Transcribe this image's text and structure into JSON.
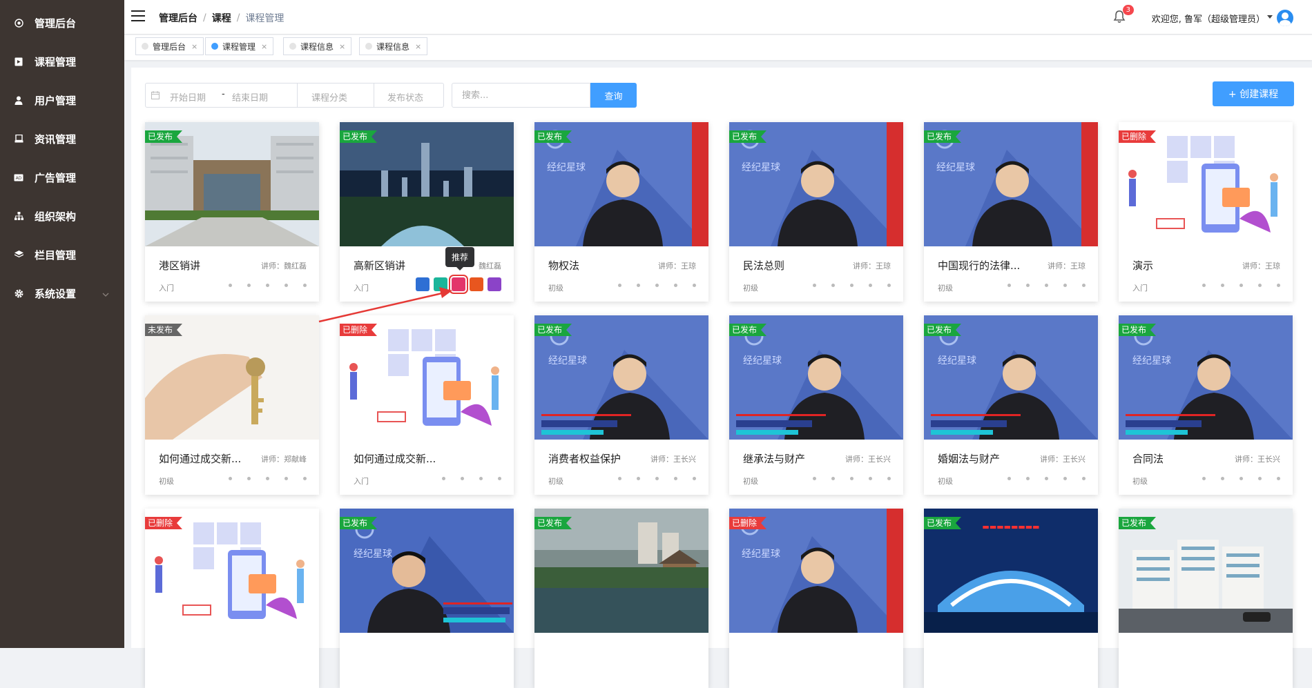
{
  "sidebar": {
    "items": [
      {
        "label": "管理后台",
        "icon": "dashboard-icon"
      },
      {
        "label": "课程管理",
        "icon": "course-icon"
      },
      {
        "label": "用户管理",
        "icon": "user-icon"
      },
      {
        "label": "资讯管理",
        "icon": "news-icon"
      },
      {
        "label": "广告管理",
        "icon": "ad-icon"
      },
      {
        "label": "组织架构",
        "icon": "org-icon"
      },
      {
        "label": "栏目管理",
        "icon": "layers-icon"
      },
      {
        "label": "系统设置",
        "icon": "gear-icon"
      }
    ]
  },
  "header": {
    "breadcrumb": [
      "管理后台",
      "课程",
      "课程管理"
    ],
    "notification_count": "3",
    "welcome": "欢迎您,  鲁军（超级管理员）"
  },
  "tabs": [
    {
      "label": "管理后台",
      "active": false
    },
    {
      "label": "课程管理",
      "active": true
    },
    {
      "label": "课程信息",
      "active": false
    },
    {
      "label": "课程信息",
      "active": false
    }
  ],
  "tab_close": "×",
  "filters": {
    "start_placeholder": "开始日期",
    "separator": "-",
    "end_placeholder": "结束日期",
    "category_placeholder": "课程分类",
    "status_placeholder": "发布状态",
    "search_placeholder": "搜索...",
    "query_label": "查询",
    "create_label": "+ 创建课程"
  },
  "tooltip": "推荐",
  "courses": [
    {
      "status": "已发布",
      "title": "港区销讲",
      "teacher": "讲师：魏红磊",
      "level": "入门",
      "thumb": "building"
    },
    {
      "status": "已发布",
      "title": "高新区销讲",
      "teacher": "魏红磊",
      "level": "入门",
      "thumb": "city"
    },
    {
      "status": "已发布",
      "title": "物权法",
      "teacher": "讲师：王琼",
      "level": "初级",
      "thumb": "video"
    },
    {
      "status": "已发布",
      "title": "民法总则",
      "teacher": "讲师：王琼",
      "level": "初级",
      "thumb": "video"
    },
    {
      "status": "已发布",
      "title": "中国现行的法律...",
      "teacher": "讲师：王琼",
      "level": "初级",
      "thumb": "video"
    },
    {
      "status": "已删除",
      "title": "演示",
      "teacher": "讲师：王琼",
      "level": "入门",
      "thumb": "illustration"
    },
    {
      "status": "未发布",
      "title": "如何通过成交新...",
      "teacher": "讲师：郑献峰",
      "level": "初级",
      "thumb": "key"
    },
    {
      "status": "已删除",
      "title": "如何通过成交新...",
      "teacher": "",
      "level": "入门",
      "thumb": "illustration"
    },
    {
      "status": "已发布",
      "title": "消费者权益保护",
      "teacher": "讲师：王长兴",
      "level": "初级",
      "thumb": "video2"
    },
    {
      "status": "已发布",
      "title": "继承法与财产",
      "teacher": "讲师：王长兴",
      "level": "初级",
      "thumb": "video2"
    },
    {
      "status": "已发布",
      "title": "婚姻法与财产",
      "teacher": "讲师：王长兴",
      "level": "初级",
      "thumb": "video2"
    },
    {
      "status": "已发布",
      "title": "合同法",
      "teacher": "讲师：王长兴",
      "level": "初级",
      "thumb": "video2"
    },
    {
      "status": "已删除",
      "title": "",
      "teacher": "",
      "level": "",
      "thumb": "illustration"
    },
    {
      "status": "已发布",
      "title": "",
      "teacher": "",
      "level": "",
      "thumb": "video3"
    },
    {
      "status": "已发布",
      "title": "",
      "teacher": "",
      "level": "",
      "thumb": "garden"
    },
    {
      "status": "已删除",
      "title": "",
      "teacher": "",
      "level": "",
      "thumb": "video"
    },
    {
      "status": "已发布",
      "title": "",
      "teacher": "",
      "level": "",
      "thumb": "night"
    },
    {
      "status": "已发布",
      "title": "",
      "teacher": "",
      "level": "",
      "thumb": "apartments"
    }
  ],
  "colors": {
    "sidebar": "#3d3531",
    "primary": "#409eff",
    "published": "#1aa63e",
    "deleted": "#e83b3b",
    "unpublished": "#666666"
  }
}
